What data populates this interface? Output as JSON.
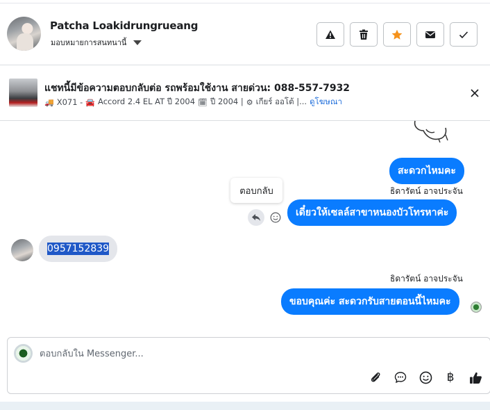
{
  "header": {
    "user_name": "Patcha Loakidrungrueang",
    "assign_label": "มอบหมายการสนทนานี้",
    "actions": [
      {
        "icon": "warning-icon"
      },
      {
        "icon": "trash-icon"
      },
      {
        "icon": "star-icon"
      },
      {
        "icon": "envelope-icon"
      },
      {
        "icon": "check-icon"
      }
    ]
  },
  "ad": {
    "title": "แชทนี้มีข้อความตอบกลับต่อ รถพร้อมใช้งาน สายด่วน: 088-557-7932",
    "code": "X071 -",
    "model": "Accord 2.4 EL AT ปี 2004",
    "year": "ปี 2004 |",
    "gear": "เกียร์ ออโต้ |...",
    "link": "ดูโฆษณา"
  },
  "messages": {
    "msg1": "สะดวกไหมคะ",
    "sender1": "ธิดารัตน์ อาจประจัน",
    "msg2": "เดี๋ยวให้เซลล์สาขาหนองบัวโทรหาค่ะ",
    "tooltip": "ตอบกลับ",
    "incoming": "0957152839",
    "sender2": "ธิดารัตน์ อาจประจัน",
    "msg3": "ขอบคุณค่ะ สะดวกรับสายตอนนี้ไหมคะ"
  },
  "composer": {
    "placeholder": "ตอบกลับใน Messenger...",
    "baht": "฿"
  },
  "colors": {
    "bubble_out": "#0a7cff",
    "bubble_in": "#e4e6eb",
    "star": "#f5921b",
    "link": "#216fdb"
  }
}
